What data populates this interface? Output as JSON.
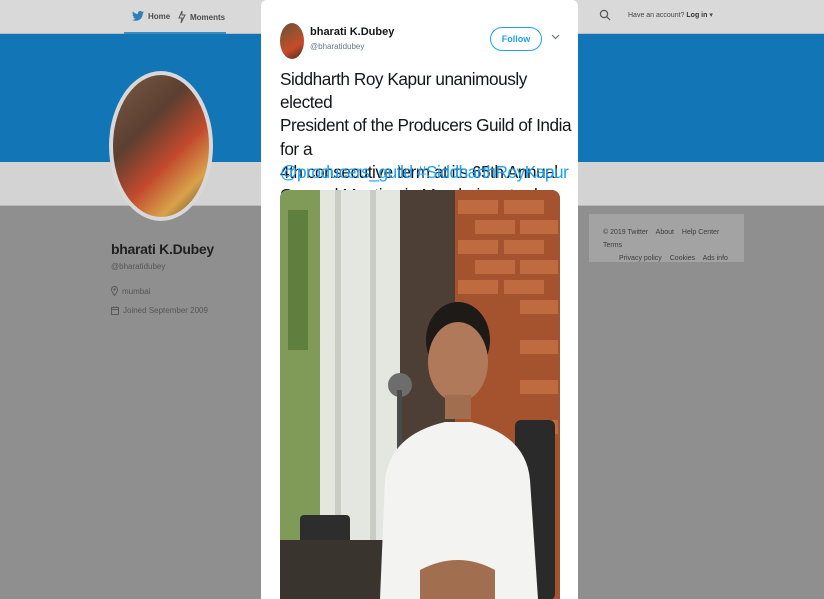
{
  "nav": {
    "home_label": "Home",
    "moments_label": "Moments",
    "account_prompt": "Have an account?",
    "login_label": "Log in"
  },
  "profile": {
    "name": "bharati K.Dubey",
    "handle": "@bharatidubey",
    "location": "mumbai",
    "joined": "Joined September 2009"
  },
  "footer": {
    "copyright": "© 2019 Twitter",
    "links": [
      "About",
      "Help Center",
      "Terms",
      "Privacy policy",
      "Cookies",
      "Ads info"
    ]
  },
  "tweet": {
    "author_name": "bharati K.Dubey",
    "author_handle": "@bharatidubey",
    "follow_label": "Follow",
    "text_line1": "Siddharth Roy Kapur unanimously elected",
    "text_line2": "President of the Producers Guild of India for a",
    "text_line3": "4th consecutive term at its 65th Annual",
    "text_line4": "General Meeting in Mumbai yesterday.",
    "mention": "@producers_guild",
    "hashtag": "#SiddharthRoyKapur"
  },
  "colors": {
    "accent": "#1da1f2",
    "banner": "#1275b5",
    "overlay_bg": "#8f8f8f"
  },
  "icons": [
    "twitter-bird-icon",
    "moments-icon",
    "search-icon",
    "chevron-down-icon",
    "location-pin-icon",
    "calendar-icon"
  ]
}
